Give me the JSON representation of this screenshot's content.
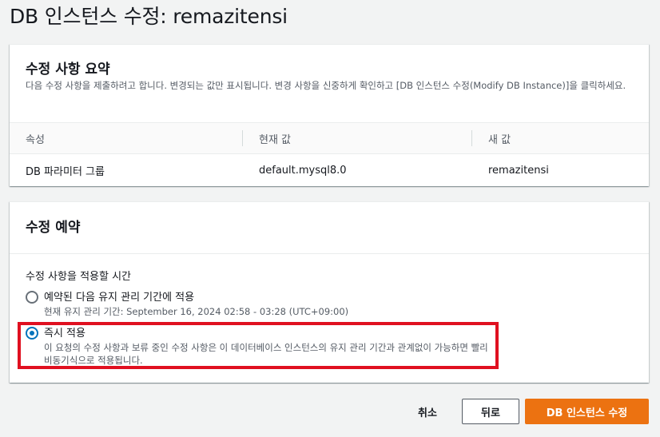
{
  "page": {
    "title": "DB 인스턴스 수정: remazitensi"
  },
  "summary": {
    "heading": "수정 사항 요약",
    "description": "다음 수정 사항을 제출하려고 합니다. 변경되는 값만 표시됩니다. 변경 사항을 신중하게 확인하고 [DB 인스턴스 수정(Modify DB Instance)]을 클릭하세요.",
    "columns": [
      "속성",
      "현재 값",
      "새 값"
    ],
    "rows": [
      {
        "attribute": "DB 파라미터 그룹",
        "current": "default.mysql8.0",
        "new": "remazitensi"
      }
    ]
  },
  "schedule": {
    "heading": "수정 예약",
    "field_label": "수정 사항을 적용할 시간",
    "options": [
      {
        "label": "예약된 다음 유지 관리 기간에 적용",
        "description": "현재 유지 관리 기간: September 16, 2024 02:58 - 03:28 (UTC+09:00)",
        "selected": false
      },
      {
        "label": "즉시 적용",
        "description": "이 요청의 수정 사항과 보류 중인 수정 사항은 이 데이터베이스 인스턴스의 유지 관리 기간과 관계없이 가능하면 빨리 비동기식으로 적용됩니다.",
        "selected": true
      }
    ],
    "highlight_color": "#e01020"
  },
  "footer": {
    "cancel_label": "취소",
    "previous_label": "뒤로",
    "submit_label": "DB 인스턴스 수정"
  },
  "colors": {
    "primary": "#ec7211",
    "radio_selected": "#0073bb"
  }
}
